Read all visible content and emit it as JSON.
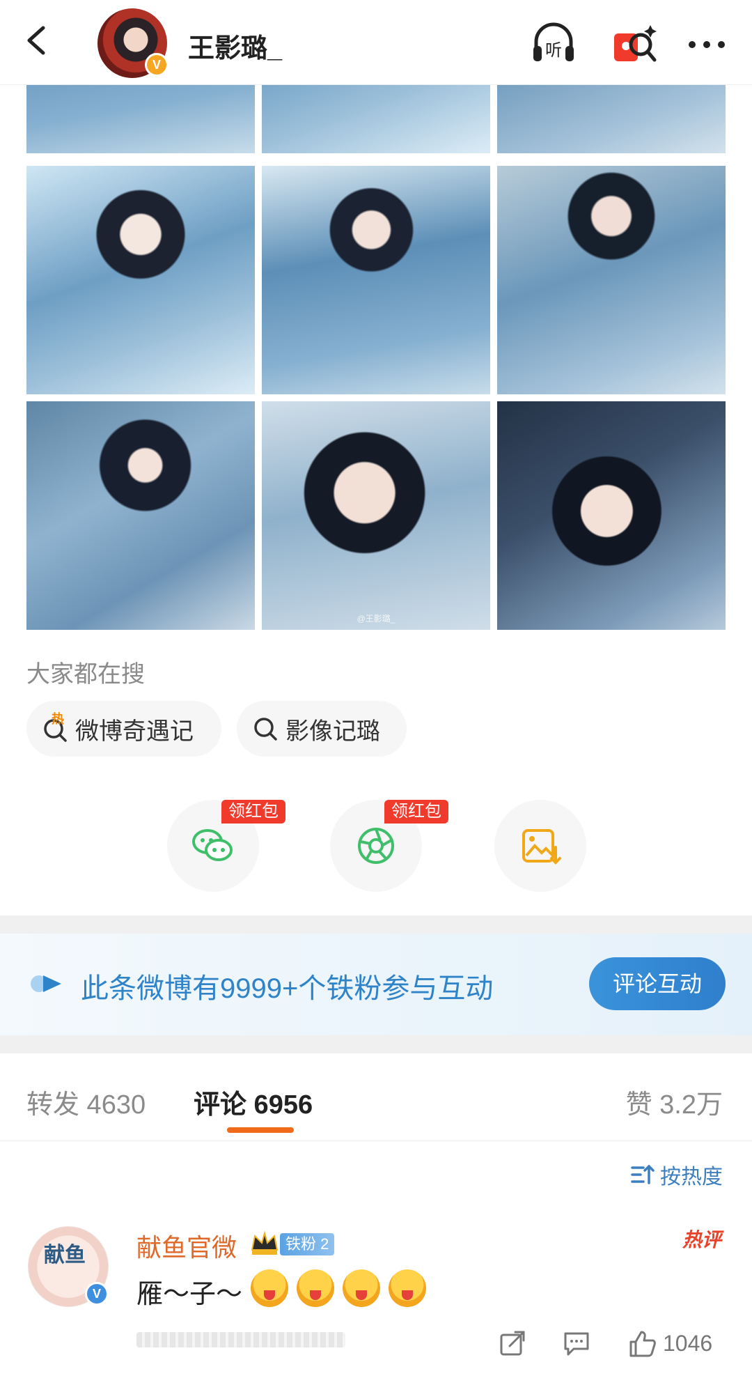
{
  "header": {
    "username": "王影璐_",
    "verified_badge": "V",
    "listen_label": "听"
  },
  "grid": {
    "watermark": "@王影璐_"
  },
  "hot_search": {
    "title": "大家都在搜",
    "hot_mark": "热",
    "items": [
      {
        "label": "微博奇遇记",
        "icon": "hot-search-icon"
      },
      {
        "label": "影像记璐",
        "icon": "search-icon"
      }
    ]
  },
  "share": {
    "redpacket_label": "领红包",
    "items": [
      {
        "name": "wechat",
        "icon": "wechat-icon",
        "tag": "领红包"
      },
      {
        "name": "moments",
        "icon": "moments-icon",
        "tag": "领红包"
      },
      {
        "name": "save-image",
        "icon": "save-image-icon"
      }
    ]
  },
  "banner": {
    "text": "此条微博有9999+个铁粉参与互动",
    "button": "评论互动"
  },
  "tabs": {
    "repost": "转发 4630",
    "comment": "评论 6956",
    "like": "赞 3.2万"
  },
  "sort": {
    "label": "按热度"
  },
  "comment": {
    "avatar_text": "献鱼",
    "name": "献鱼官微",
    "fan_badge": "铁粉 2",
    "hot_label": "热评",
    "text": "雁～子～",
    "emoji_count": 4,
    "like_count": "1046"
  },
  "colors": {
    "accent_orange": "#f06a1a",
    "link_blue": "#2f84c9",
    "red_tag": "#f03a2c",
    "wechat_green": "#3fbf6a"
  }
}
